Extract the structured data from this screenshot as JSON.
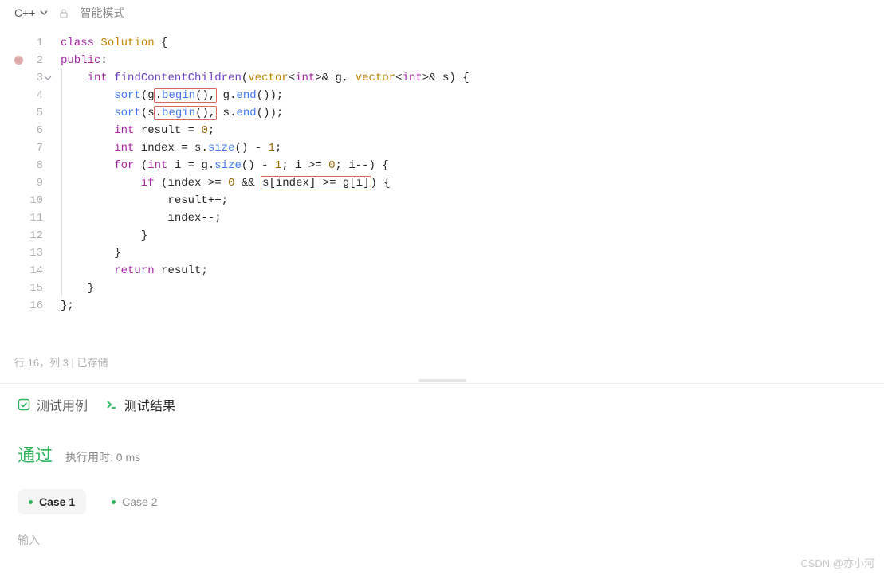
{
  "toolbar": {
    "language": "C++",
    "mode": "智能模式"
  },
  "editor": {
    "lines": 16,
    "status": "行 16，列 3  |  已存储"
  },
  "code": {
    "l1": "class Solution {",
    "l2": "public:",
    "l3": "    int findContentChildren(vector<int>& g, vector<int>& s) {",
    "l4": "        sort(g.begin(), g.end());",
    "l5": "        sort(s.begin(), s.end());",
    "l6": "        int result = 0;",
    "l7": "        int index = s.size() - 1;",
    "l8": "        for (int i = g.size() - 1; i >= 0; i--) {",
    "l9": "            if (index >= 0 && s[index] >= g[i]) {",
    "l10": "                result++;",
    "l11": "                index--;",
    "l12": "            }",
    "l13": "        }",
    "l14": "        return result;",
    "l15": "    }",
    "l16": "};"
  },
  "panel": {
    "tab_cases": "测试用例",
    "tab_results": "测试结果",
    "pass": "通过",
    "runtime_label": "执行用时: 0 ms",
    "cases": {
      "c1": "Case 1",
      "c2": "Case 2"
    },
    "input_label": "输入"
  },
  "watermark": "CSDN @亦小河"
}
